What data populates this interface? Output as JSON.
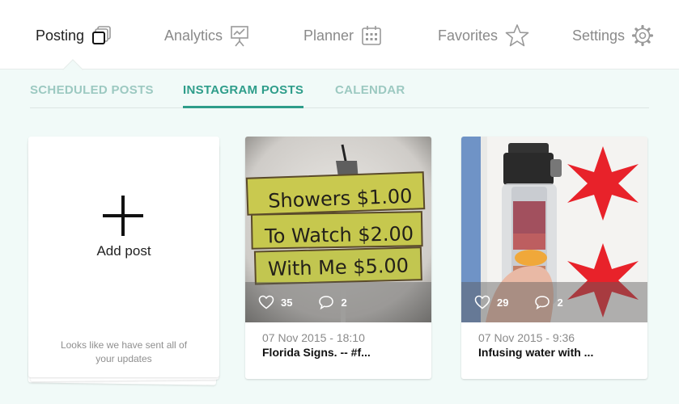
{
  "nav": {
    "items": [
      {
        "label": "Posting",
        "icon": "posting-icon",
        "active": true
      },
      {
        "label": "Analytics",
        "icon": "presentation-chart-icon",
        "active": false
      },
      {
        "label": "Planner",
        "icon": "calendar-icon",
        "active": false
      },
      {
        "label": "Favorites",
        "icon": "star-icon",
        "active": false
      },
      {
        "label": "Settings",
        "icon": "gear-icon",
        "active": false
      }
    ]
  },
  "tabs": [
    {
      "label": "SCHEDULED POSTS",
      "active": false
    },
    {
      "label": "INSTAGRAM POSTS",
      "active": true
    },
    {
      "label": "CALENDAR",
      "active": false
    }
  ],
  "add_card": {
    "label": "Add post",
    "message": "Looks like we have sent all of your updates"
  },
  "posts": [
    {
      "likes": "35",
      "comments": "2",
      "date": "07 Nov 2015 - 18:10",
      "caption": "Florida Signs. -- #f...",
      "sign_lines": [
        "Showers $1.00",
        "To Watch $2.00",
        "With Me $5.00"
      ]
    },
    {
      "likes": "29",
      "comments": "2",
      "date": "07 Nov 2015 - 9:36",
      "caption": "Infusing water with ..."
    }
  ],
  "colors": {
    "accent": "#2e9d8a",
    "tab_inactive": "#9cc9c1",
    "background": "#f1faf8"
  }
}
